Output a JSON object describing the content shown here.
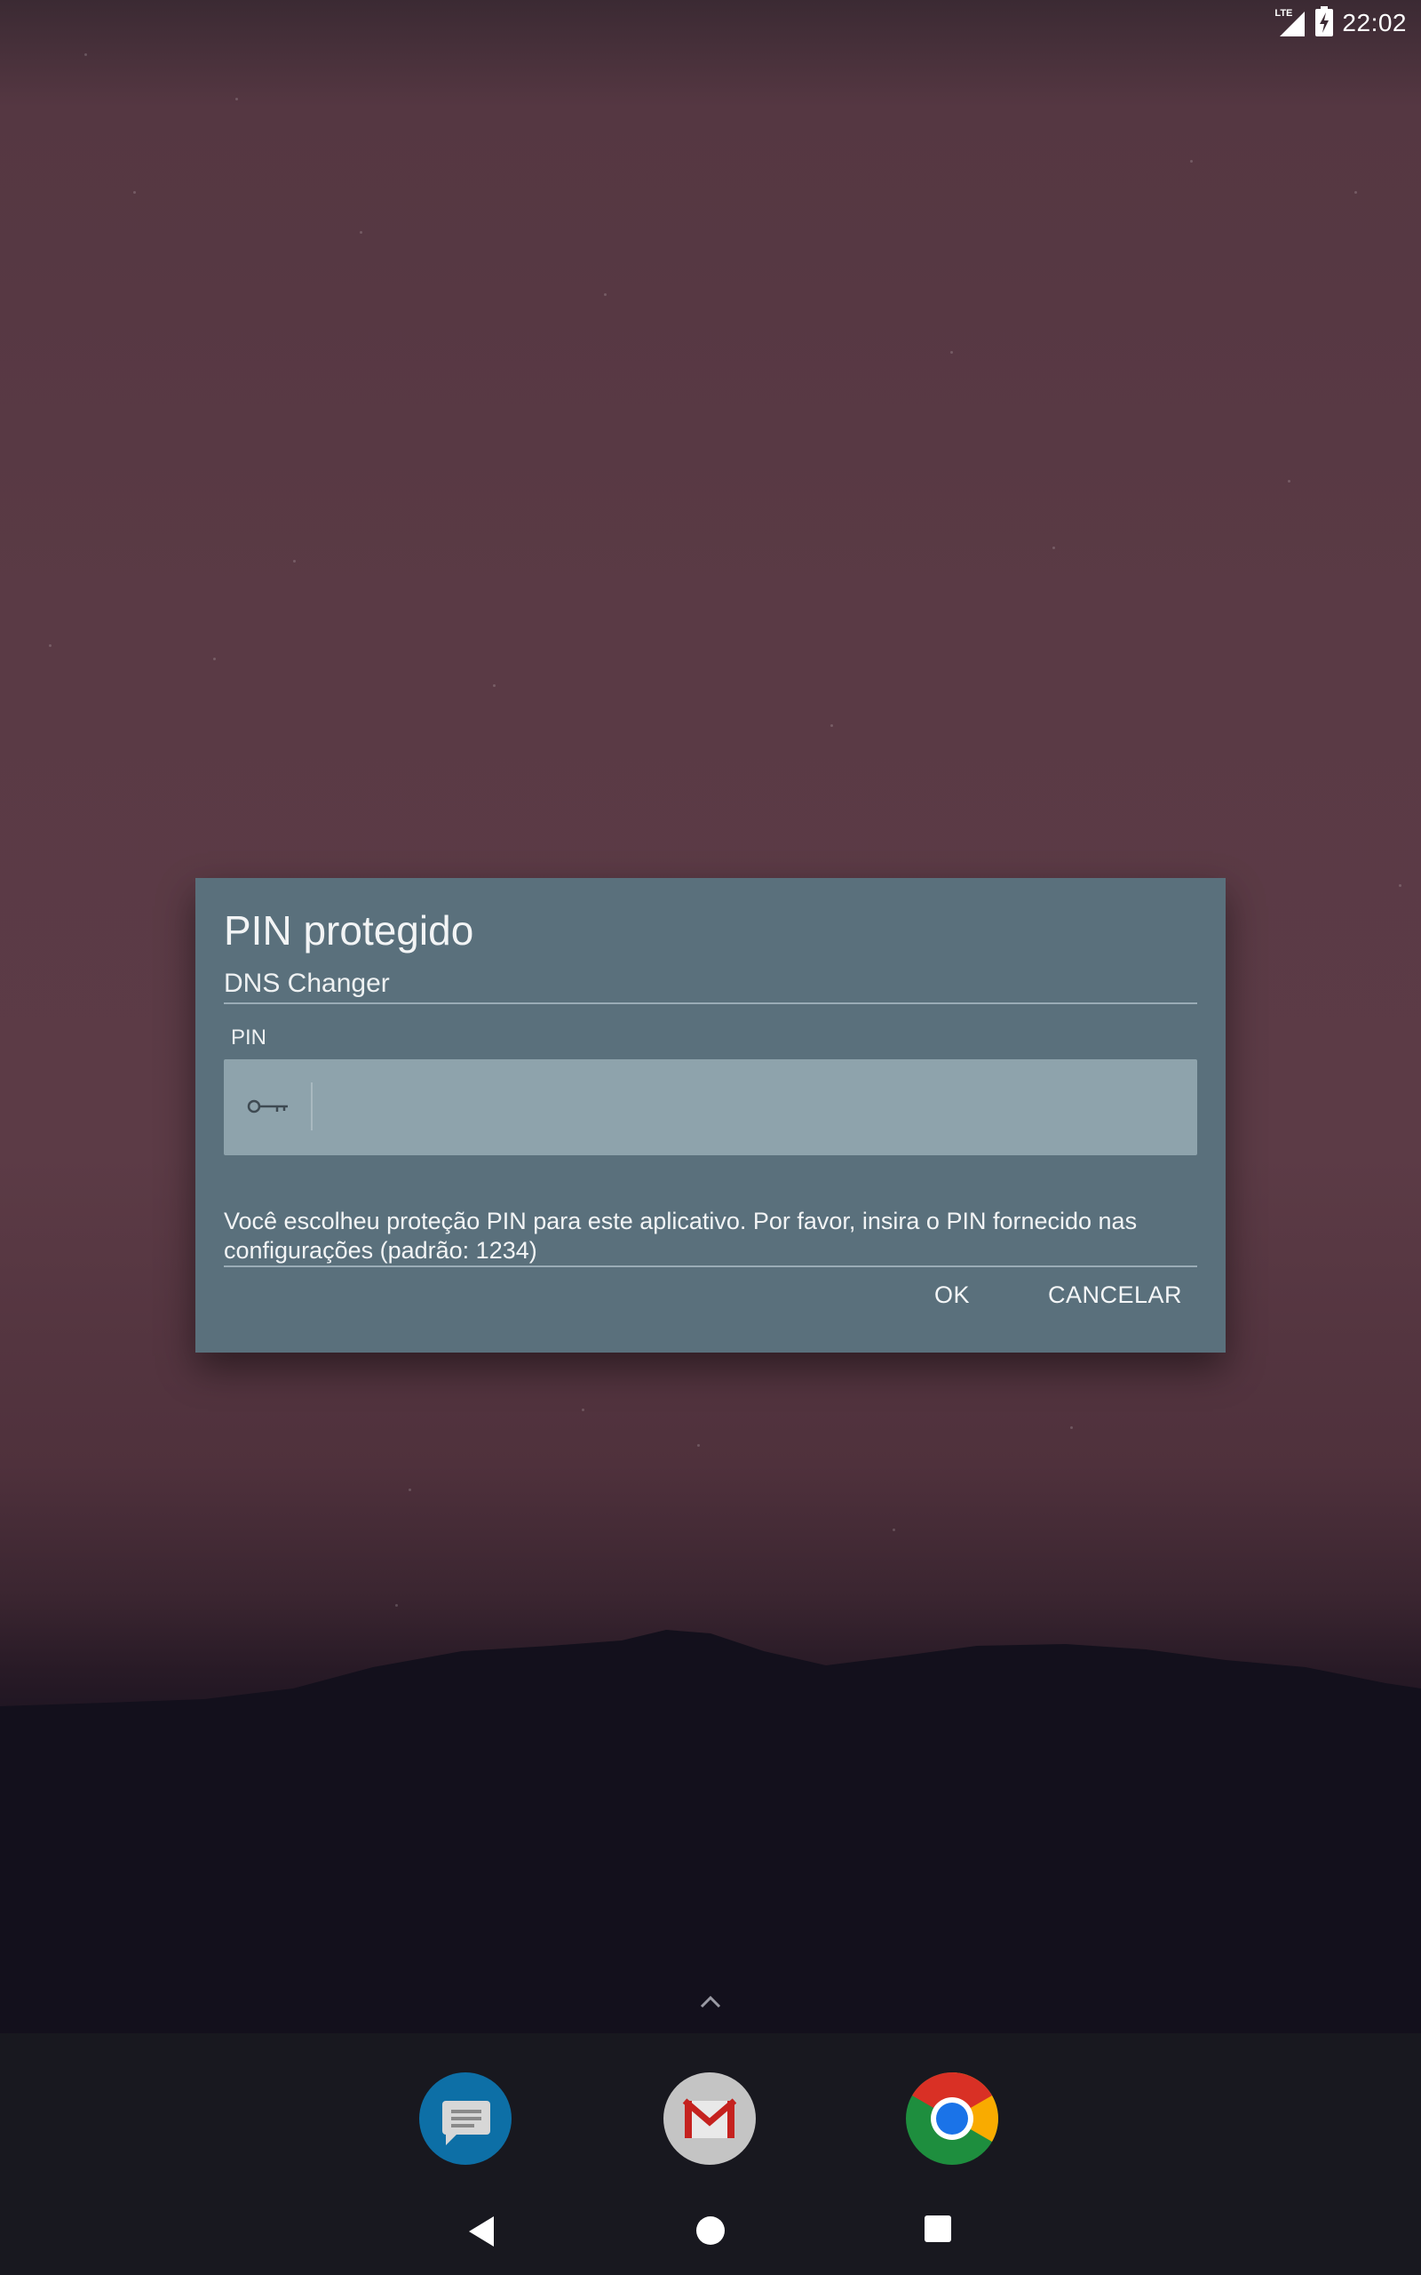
{
  "status_bar": {
    "network_label": "LTE",
    "time": "22:02",
    "icons": [
      "lte-signal-icon",
      "battery-charging-icon"
    ]
  },
  "dialog": {
    "title": "PIN protegido",
    "subtitle": "DNS Changer",
    "pin_label": "PIN",
    "pin_value": "",
    "message": "Você escolheu proteção PIN para este aplicativo. Por favor, insira o PIN fornecido nas configurações (padrão: 1234)",
    "ok_label": "OK",
    "cancel_label": "CANCELAR",
    "icons": [
      "key-icon"
    ]
  },
  "dock": {
    "apps": [
      {
        "name": "Messages",
        "icon": "messages-app-icon"
      },
      {
        "name": "Gmail",
        "icon": "gmail-app-icon"
      },
      {
        "name": "Chrome",
        "icon": "chrome-app-icon"
      }
    ]
  },
  "navigation": {
    "buttons": [
      "back-icon",
      "home-icon",
      "recents-icon"
    ]
  },
  "colors": {
    "dialog_background": "#5a707c",
    "pin_field_background": "#8ea3ac",
    "dock_background": "#18181f"
  }
}
